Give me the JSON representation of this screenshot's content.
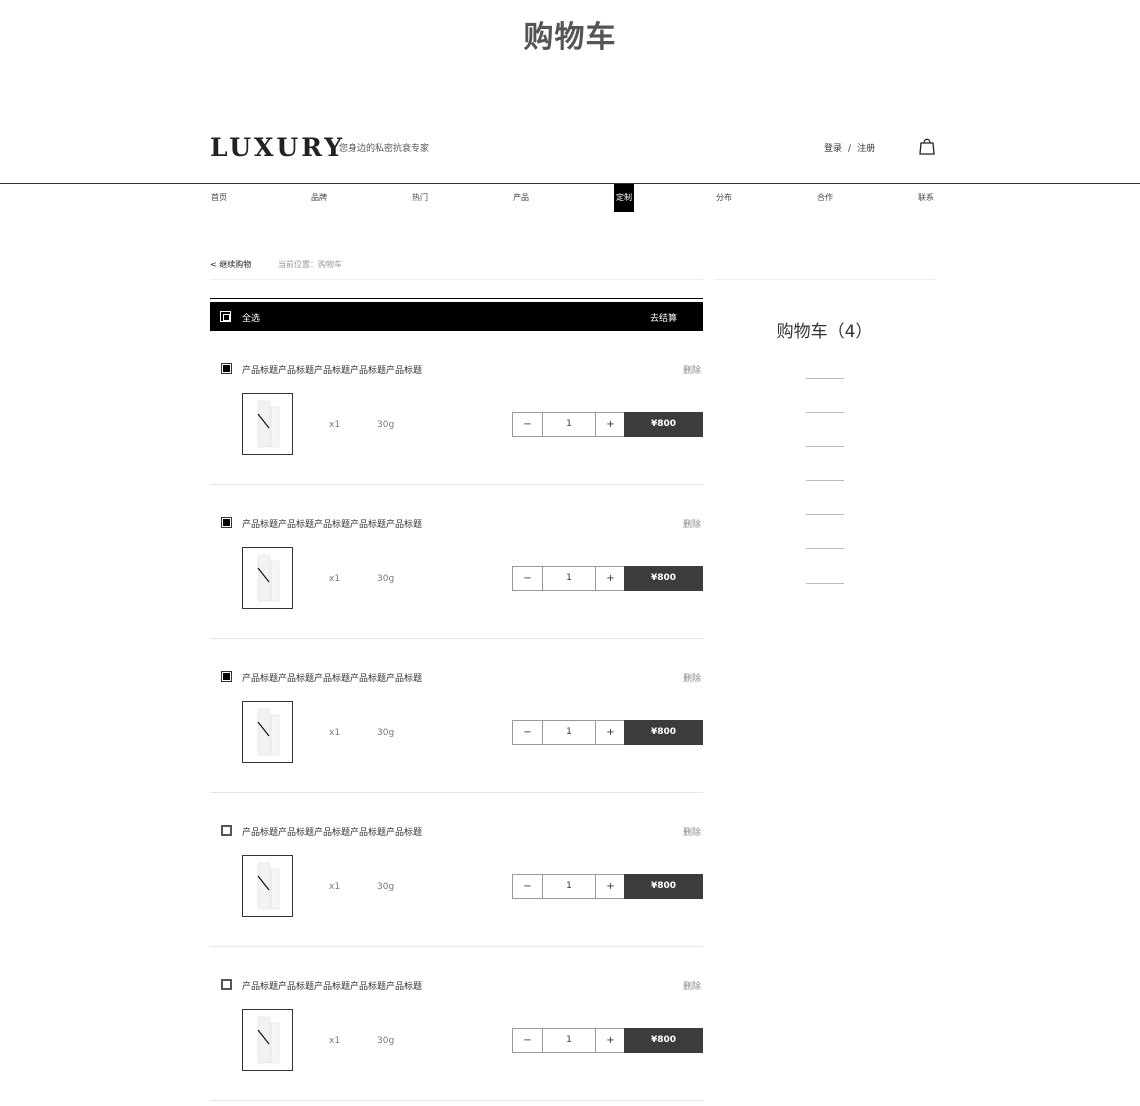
{
  "page": {
    "title": "购物车"
  },
  "header": {
    "logo": "LUXURY",
    "tagline": "您身边的私密抗衰专家",
    "login": "登录",
    "separator": "/",
    "register": "注册",
    "cart_icon": "shopping-bag-icon"
  },
  "nav": {
    "items": [
      "首页",
      "品牌",
      "热门",
      "产品",
      "定制",
      "分布",
      "合作",
      "联系"
    ],
    "active": "定制"
  },
  "breadcrumb": {
    "back": "< 继续购物",
    "location": "当前位置：购物车"
  },
  "table_header": {
    "select_all": "全选",
    "checkout": "去结算"
  },
  "cart": {
    "items": [
      {
        "title": "产品标题产品标题产品标题产品标题产品标题",
        "delete": "删除",
        "checked": true,
        "qty_text": "x1",
        "weight": "30g",
        "minus": "−",
        "quantity": "1",
        "plus": "+",
        "price": "¥800"
      },
      {
        "title": "产品标题产品标题产品标题产品标题产品标题",
        "delete": "删除",
        "checked": true,
        "qty_text": "x1",
        "weight": "30g",
        "minus": "−",
        "quantity": "1",
        "plus": "+",
        "price": "¥800"
      },
      {
        "title": "产品标题产品标题产品标题产品标题产品标题",
        "delete": "删除",
        "checked": true,
        "qty_text": "x1",
        "weight": "30g",
        "minus": "−",
        "quantity": "1",
        "plus": "+",
        "price": "¥800"
      },
      {
        "title": "产品标题产品标题产品标题产品标题产品标题",
        "delete": "删除",
        "checked": false,
        "qty_text": "x1",
        "weight": "30g",
        "minus": "−",
        "quantity": "1",
        "plus": "+",
        "price": "¥800"
      },
      {
        "title": "产品标题产品标题产品标题产品标题产品标题",
        "delete": "删除",
        "checked": false,
        "qty_text": "x1",
        "weight": "30g",
        "minus": "−",
        "quantity": "1",
        "plus": "+",
        "price": "¥800"
      }
    ]
  },
  "summary": {
    "title": "购物车（4）"
  },
  "colors": {
    "header_bar": "#000000",
    "price_button": "#3c3c3c"
  }
}
